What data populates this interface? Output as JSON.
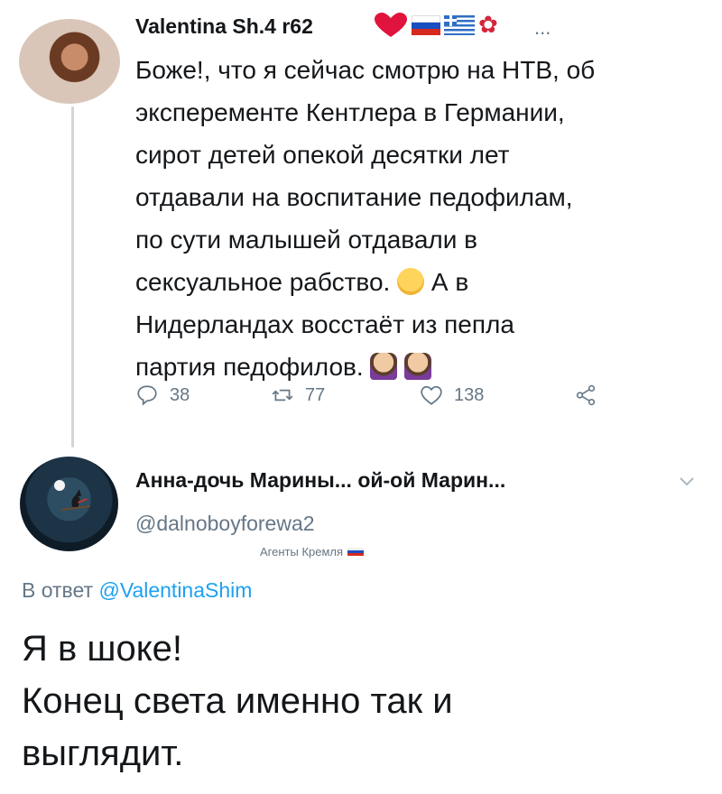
{
  "tweet": {
    "author_name": "Valentina Sh.4 r62",
    "more_symbol": "...",
    "lines": [
      "Боже!, что я сейчас смотрю на НТВ, об",
      "эксперементе Кентлера в Германии,",
      "сирот детей опекой десятки лет",
      "отдавали на воспитание педофилам,",
      "по сути малышей отдавали в",
      "сексуальное рабство.",
      " А в",
      "Нидерландах восстаёт из пепла",
      "партия педофилов."
    ],
    "actions": {
      "replies": "38",
      "retweets": "77",
      "likes": "138"
    },
    "icons": [
      "avatar-photo",
      "heart-emoji",
      "russia-flag",
      "greece-flag",
      "rose-emoji",
      "crying-face-emoji",
      "facepalm-emoji",
      "reply-icon",
      "retweet-icon",
      "like-icon",
      "share-icon"
    ]
  },
  "reply": {
    "author_name": "Анна-дочь Марины... ой-ой Марин...",
    "handle": "@dalnoboyforewa2",
    "badge": "Агенты Кремля",
    "reply_prefix": "В ответ ",
    "reply_to": "@ValentinaShim",
    "lines": [
      "Я в шоке!",
      "Конец света именно так и",
      "выглядит."
    ],
    "icons": [
      "avatar-moon-witch",
      "chevron-down-icon",
      "russia-flag"
    ]
  },
  "colors": {
    "text": "#14171a",
    "muted": "#657786",
    "link": "#1da1f2",
    "thread_line": "#cfd6dc"
  }
}
